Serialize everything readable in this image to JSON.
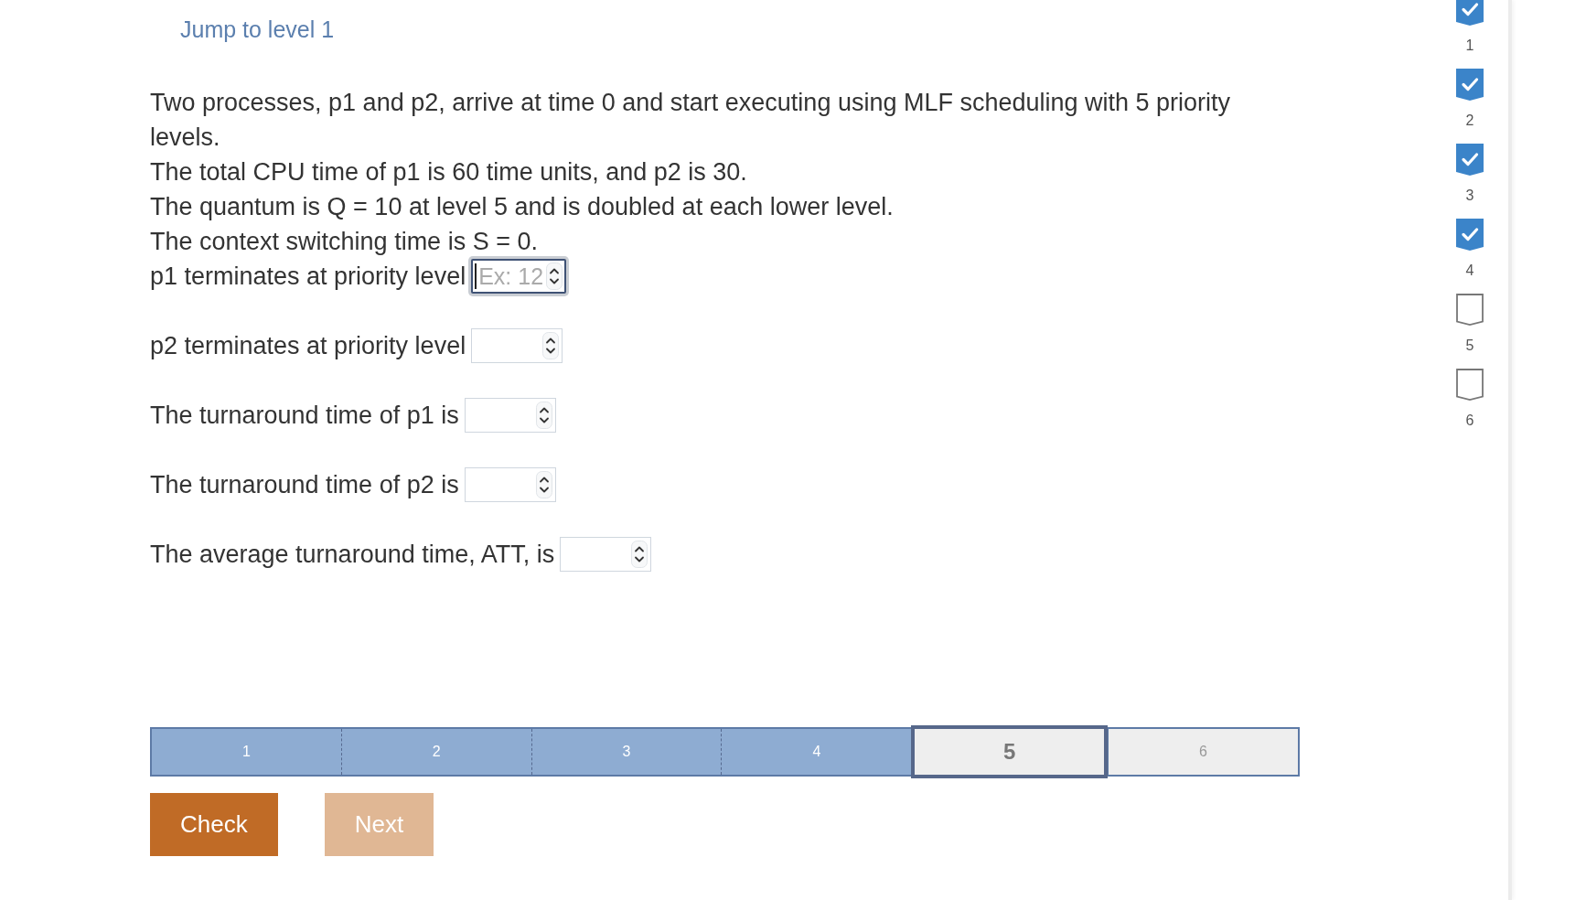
{
  "jump_link": "Jump to level 1",
  "question": [
    "Two processes, p1 and p2, arrive at time 0 and start executing using MLF scheduling with 5 priority levels.",
    "The total CPU time of p1 is 60 time units, and p2 is 30.",
    "The quantum is Q = 10 at level 5 and is doubled at each lower level.",
    "The context switching time is S = 0."
  ],
  "fields": [
    {
      "label": "p1 terminates at priority level",
      "placeholder": "Ex: 12",
      "focused": true
    },
    {
      "label": "p2 terminates at priority level",
      "focused": false
    },
    {
      "label": "The turnaround time of p1 is",
      "focused": false
    },
    {
      "label": "The turnaround time of p2 is",
      "focused": false
    },
    {
      "label": "The average turnaround time, ATT, is",
      "focused": false
    }
  ],
  "progress": [
    {
      "label": "1",
      "completed": true,
      "selected": false
    },
    {
      "label": "2",
      "completed": true,
      "selected": false
    },
    {
      "label": "3",
      "completed": true,
      "selected": false
    },
    {
      "label": "4",
      "completed": true,
      "selected": false
    },
    {
      "label": "5",
      "completed": false,
      "selected": true
    },
    {
      "label": "6",
      "completed": false,
      "selected": false
    }
  ],
  "buttons": {
    "check": {
      "label": "Check",
      "disabled": false
    },
    "next": {
      "label": "Next",
      "disabled": true
    }
  },
  "sidebar": {
    "items": [
      {
        "label": "1",
        "checked": true
      },
      {
        "label": "2",
        "checked": true
      },
      {
        "label": "3",
        "checked": true
      },
      {
        "label": "4",
        "checked": true
      },
      {
        "label": "5",
        "checked": false
      },
      {
        "label": "6",
        "checked": false
      }
    ]
  }
}
